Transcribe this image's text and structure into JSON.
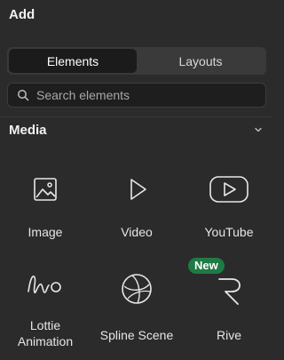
{
  "panel": {
    "title": "Add"
  },
  "tabs": [
    {
      "label": "Elements",
      "active": true
    },
    {
      "label": "Layouts",
      "active": false
    }
  ],
  "search": {
    "placeholder": "Search elements",
    "value": ""
  },
  "section": {
    "title": "Media",
    "expanded": true
  },
  "items": [
    {
      "label": "Image",
      "icon": "image-icon"
    },
    {
      "label": "Video",
      "icon": "play-icon"
    },
    {
      "label": "YouTube",
      "icon": "youtube-icon"
    },
    {
      "label": "Lottie Animation",
      "label_line1": "Lottie",
      "label_line2": "Animation",
      "icon": "lottie-icon"
    },
    {
      "label": "Spline Scene",
      "icon": "spline-icon"
    },
    {
      "label": "Rive",
      "icon": "rive-icon",
      "badge": "New"
    }
  ],
  "colors": {
    "background": "#2b2b2b",
    "tab_active": "#1b1b1b",
    "tab_track": "#3a3a3a",
    "badge": "#1f7a44"
  }
}
